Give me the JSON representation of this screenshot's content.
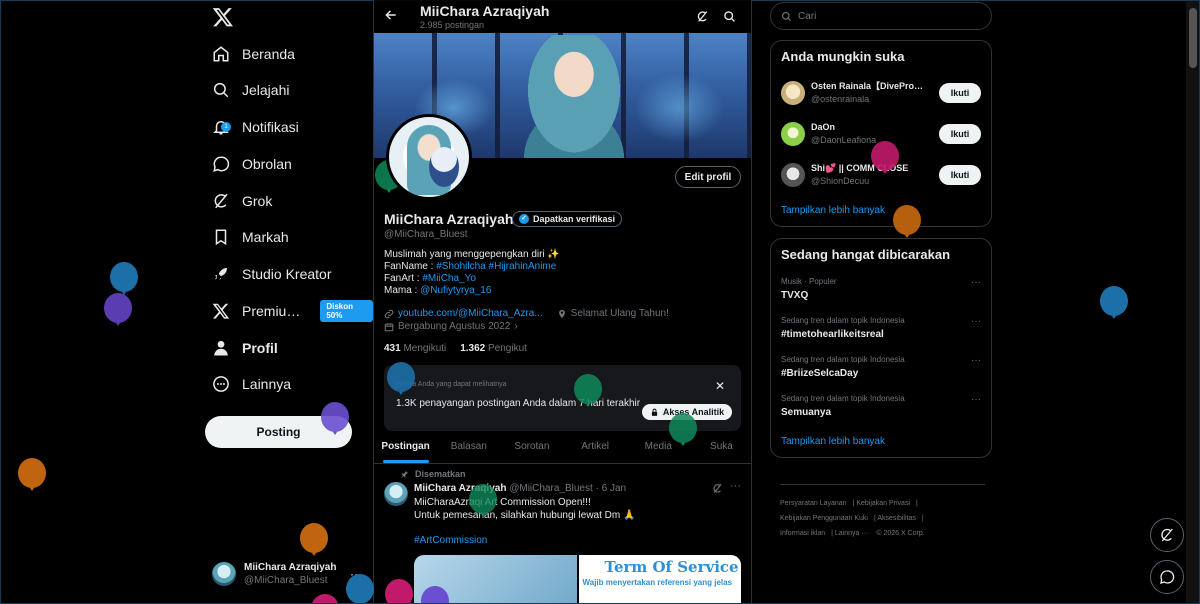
{
  "nav": {
    "items": [
      {
        "label": "Beranda",
        "icon": "home-icon"
      },
      {
        "label": "Jelajahi",
        "icon": "search-icon"
      },
      {
        "label": "Notifikasi",
        "icon": "bell-icon",
        "badge": "1"
      },
      {
        "label": "Obrolan",
        "icon": "chat-icon"
      },
      {
        "label": "Grok",
        "icon": "grok-icon"
      },
      {
        "label": "Markah",
        "icon": "bookmark-icon"
      },
      {
        "label": "Studio Kreator",
        "icon": "rocket-icon"
      },
      {
        "label": "Premiu…",
        "icon": "x-icon",
        "badge": "Diskon 50%"
      },
      {
        "label": "Profil",
        "icon": "person-icon"
      },
      {
        "label": "Lainnya",
        "icon": "more-circle-icon"
      }
    ],
    "post_button": "Posting",
    "account": {
      "name": "MiiChara Azraqiyah",
      "handle": "@MiiChara_Bluest",
      "more": "···"
    }
  },
  "header": {
    "title": "MiiChara Azraqiyah",
    "subtitle": "2.985 postingan"
  },
  "profile": {
    "edit_button": "Edit profil",
    "name": "MiiChara Azraqiyah",
    "verify_label": "Dapatkan verifikasi",
    "handle": "@MiiChara_Bluest",
    "bio": {
      "line1": "Muslimah yang menggepengkan diri ✨",
      "fanname_label": "FanName : ",
      "fanname_value": "#Shohilcha #HijrahinAnime",
      "fanart_label": "FanArt : ",
      "fanart_value": "#MiiCha_Yo",
      "mama_label": "Mama : ",
      "mama_value": "@Nufiytyrya_16"
    },
    "link": "youtube.com/@MiiChara_Azra...",
    "location": "Selamat Ulang Tahun!",
    "joined": "Bergabung Agustus 2022",
    "following_count": "431",
    "following_label": "Mengikuti",
    "followers_count": "1.362",
    "followers_label": "Pengikut"
  },
  "analytics": {
    "private_note": "Hanya Anda yang dapat melihatnya",
    "text": "1.3K penayangan postingan Anda dalam 7 hari terakhir",
    "button": "Akses Analitik",
    "close": "✕"
  },
  "tabs": [
    "Postingan",
    "Balasan",
    "Sorotan",
    "Artikel",
    "Media",
    "Suka"
  ],
  "tweet": {
    "pinned": "Disematkan",
    "name": "MiiChara Azraqiyah",
    "handle": "@MiiChara_Bluest",
    "date": "· 6 Jan",
    "body": "MiiCharaAzraqi Art Commission Open!!!\nUntuk pemesanan, silahkan hubungi lewat Dm 🙏",
    "hashtag": "#ArtCommission",
    "media_title": "Term Of Service",
    "media_note": "Wajib menyertakan referensi yang jelas"
  },
  "right": {
    "search_placeholder": "Cari",
    "who_to_follow": {
      "title": "Anda mungkin suka",
      "users": [
        {
          "name": "Osten Rainala【DivePro…",
          "handle": "@ostenrainala",
          "button": "Ikuti"
        },
        {
          "name": "DaOn",
          "handle": "@DaonLeafiona",
          "button": "Ikuti"
        },
        {
          "name": "Shi💕 || COMM CLOSE",
          "handle": "@ShionDecuu",
          "button": "Ikuti"
        }
      ],
      "show_more": "Tampilkan lebih banyak"
    },
    "trending": {
      "title": "Sedang hangat dibicarakan",
      "items": [
        {
          "context": "Musik · Populer",
          "topic": "TVXQ"
        },
        {
          "context": "Sedang tren dalam topik Indonesia",
          "topic": "#timetohearlikeitsreal"
        },
        {
          "context": "Sedang tren dalam topik Indonesia",
          "topic": "#BriizeSelcaDay"
        },
        {
          "context": "Sedang tren dalam topik Indonesia",
          "topic": "Semuanya"
        }
      ],
      "show_more": "Tampilkan lebih banyak",
      "dots": "···"
    },
    "footer": [
      "Persyaratan Layanan",
      "Kebijakan Privasi",
      "Kebijakan Penggunaan Kuki",
      "Aksesibilitas",
      "Informasi iklan",
      "Lainnya ···",
      "© 2026 X Corp."
    ]
  },
  "colors": {
    "accent": "#1d9bf0",
    "background": "#000000",
    "border": "#2f3336",
    "muted": "#71767b"
  }
}
